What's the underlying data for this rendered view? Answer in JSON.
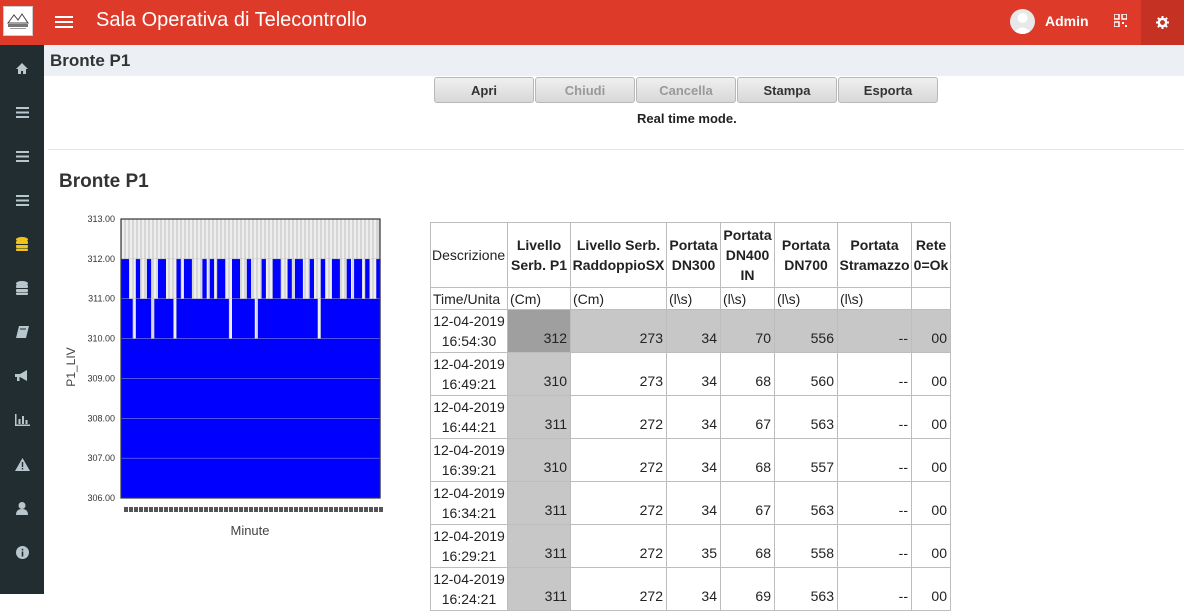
{
  "app": {
    "title": "Sala Operativa di Telecontrollo",
    "user": "Admin",
    "accent": "#dd3a2a",
    "sidebar_bg": "#222d32"
  },
  "sidebar": {
    "items": [
      {
        "icon": "home-icon"
      },
      {
        "icon": "list-icon"
      },
      {
        "icon": "list-icon"
      },
      {
        "icon": "list-icon"
      },
      {
        "icon": "database-icon",
        "active_color": "#f0c419"
      },
      {
        "icon": "database-icon"
      },
      {
        "icon": "book-icon"
      },
      {
        "icon": "bullhorn-icon"
      },
      {
        "icon": "bar-chart-icon"
      },
      {
        "icon": "warning-icon"
      },
      {
        "icon": "user-icon"
      },
      {
        "icon": "info-icon"
      }
    ]
  },
  "page": {
    "header": "Bronte P1",
    "section_title": "Bronte P1",
    "mode_text": "Real time mode."
  },
  "toolbar": {
    "apri": "Apri",
    "chiudi": "Chiudi",
    "cancella": "Cancella",
    "stampa": "Stampa",
    "esporta": "Esporta"
  },
  "chart_data": {
    "type": "area",
    "title": "",
    "xlabel": "Minute",
    "ylabel": "P1_LIV",
    "ylim": [
      306.0,
      313.0
    ],
    "yticks": [
      "313.00",
      "312.00",
      "311.00",
      "310.00",
      "309.00",
      "308.00",
      "307.00",
      "306.00"
    ],
    "series_color": "#0000ff",
    "background_color": "#d6d6d6",
    "grid": true,
    "description_levels": "level oscillating mostly between 310 and 312",
    "values": [
      312,
      312,
      311,
      310,
      312,
      311,
      311,
      312,
      310,
      311,
      312,
      312,
      311,
      311,
      310,
      312,
      311,
      312,
      312,
      311,
      311,
      311,
      312,
      311,
      312,
      311,
      312,
      312,
      311,
      310,
      312,
      312,
      311,
      311,
      312,
      311,
      310,
      311,
      312,
      311,
      311,
      312,
      312,
      311,
      311,
      312,
      311,
      312,
      312,
      311,
      311,
      312,
      311,
      310,
      312,
      311,
      311,
      312,
      312,
      311,
      311,
      312,
      311,
      312,
      312,
      311,
      312,
      311,
      311,
      312
    ]
  },
  "table": {
    "headers": {
      "descrizione": "Descrizione",
      "livello_l1": "Livello",
      "livello_l2": "Serb. P1",
      "raddoppio_l1": "Livello Serb.",
      "raddoppio_l2": "RaddoppioSX",
      "dn300_l1": "Portata",
      "dn300_l2": "DN300",
      "dn400_l1": "Portata",
      "dn400_l2": "DN400",
      "dn400_l3": "IN",
      "dn700_l1": "Portata",
      "dn700_l2": "DN700",
      "stramazzo_l1": "Portata",
      "stramazzo_l2": "Stramazzo",
      "rete_l1": "Rete",
      "rete_l2": "0=Ok"
    },
    "units": {
      "label": "Time/Unita",
      "livello": "(Cm)",
      "raddoppio": "(Cm)",
      "dn300": "(l\\s)",
      "dn400": "(l\\s)",
      "dn700": "(l\\s)",
      "stramazzo": "(l\\s)",
      "rete": ""
    },
    "rows": [
      {
        "date": "12-04-2019",
        "time": "16:54:30",
        "livello": "312",
        "raddoppio": "273",
        "dn300": "34",
        "dn400": "70",
        "dn700": "556",
        "stramazzo": "--",
        "rete": "00"
      },
      {
        "date": "12-04-2019",
        "time": "16:49:21",
        "livello": "310",
        "raddoppio": "273",
        "dn300": "34",
        "dn400": "68",
        "dn700": "560",
        "stramazzo": "--",
        "rete": "00"
      },
      {
        "date": "12-04-2019",
        "time": "16:44:21",
        "livello": "311",
        "raddoppio": "272",
        "dn300": "34",
        "dn400": "67",
        "dn700": "563",
        "stramazzo": "--",
        "rete": "00"
      },
      {
        "date": "12-04-2019",
        "time": "16:39:21",
        "livello": "310",
        "raddoppio": "272",
        "dn300": "34",
        "dn400": "68",
        "dn700": "557",
        "stramazzo": "--",
        "rete": "00"
      },
      {
        "date": "12-04-2019",
        "time": "16:34:21",
        "livello": "311",
        "raddoppio": "272",
        "dn300": "34",
        "dn400": "67",
        "dn700": "563",
        "stramazzo": "--",
        "rete": "00"
      },
      {
        "date": "12-04-2019",
        "time": "16:29:21",
        "livello": "311",
        "raddoppio": "272",
        "dn300": "35",
        "dn400": "68",
        "dn700": "558",
        "stramazzo": "--",
        "rete": "00"
      },
      {
        "date": "12-04-2019",
        "time": "16:24:21",
        "livello": "311",
        "raddoppio": "272",
        "dn300": "34",
        "dn400": "69",
        "dn700": "563",
        "stramazzo": "--",
        "rete": "00"
      }
    ]
  }
}
